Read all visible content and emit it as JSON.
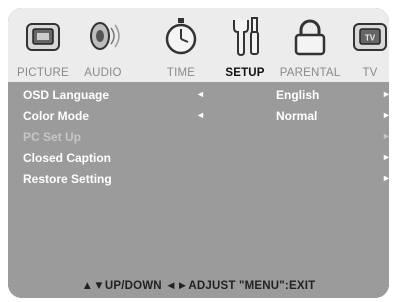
{
  "tabs": [
    {
      "label": "PICTURE",
      "icon": "picture-icon"
    },
    {
      "label": "AUDIO",
      "icon": "speaker-icon"
    },
    {
      "label": "TIME",
      "icon": "stopwatch-icon"
    },
    {
      "label": "SETUP",
      "icon": "tools-icon",
      "active": true
    },
    {
      "label": "PARENTAL",
      "icon": "lock-icon"
    },
    {
      "label": "TV",
      "icon": "tv-icon"
    }
  ],
  "menu": [
    {
      "name": "OSD Language",
      "value": "English",
      "left_arrow": "◄",
      "right_arrow": "►"
    },
    {
      "name": "Color Mode",
      "value": "Normal",
      "left_arrow": "◄",
      "right_arrow": "►"
    },
    {
      "name": "PC Set Up",
      "value": "",
      "left_arrow": "",
      "right_arrow": "►",
      "disabled": true
    },
    {
      "name": "Closed Caption",
      "value": "",
      "left_arrow": "",
      "right_arrow": "►"
    },
    {
      "name": "Restore Setting",
      "value": "",
      "left_arrow": "",
      "right_arrow": "►"
    }
  ],
  "hint": "▲▼UP/DOWN  ◄►ADJUST  \"MENU\":EXIT"
}
